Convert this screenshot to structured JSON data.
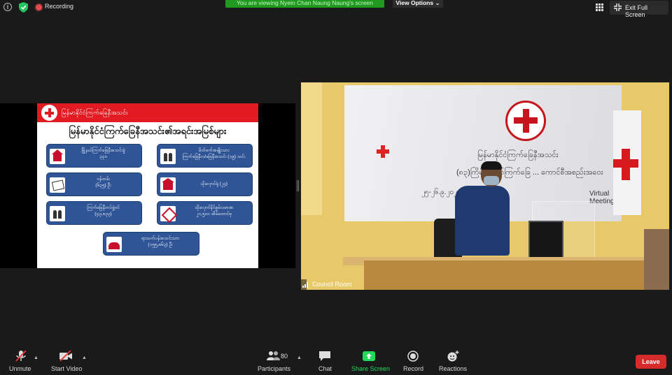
{
  "topbar": {
    "recording_label": "Recording",
    "viewing_banner": "You are viewing Nyein Chan Naung Naung's screen",
    "view_options_label": "View Options",
    "exit_fullscreen_label": "Exit Full Screen"
  },
  "slide": {
    "org_name": "မြန်မာနိုင်ငံကြက်ခြေနီအသင်း",
    "title": "မြန်မာနိုင်ငံကြက်ခြေနီအသင်း၏အရင်းအမြစ်များ",
    "boxes": [
      {
        "line1": "မြို့နယ်ကြက်ခြေနီအသင်းခွဲ",
        "line2": "၃၃၀"
      },
      {
        "line1": "မိတ်ဖက်အမျိုးသား",
        "line2": "ကြက်ခြေနီလ/ခြေနီအသင်း (၁၉) သင်း"
      },
      {
        "line1": "ဝန်ထမ်း",
        "line2": "(၆၃၅) ဦး"
      },
      {
        "line1": "သိုလှောင်ရုံ (၂၄)",
        "line2": ""
      },
      {
        "line1": "ကြက်ခြေနီတပ်ဖွဲ့ဝင်",
        "line2": "(၄၃,၈၃၃)"
      },
      {
        "line1": "သိုလှောင်နိုင်စွမ်းပမာဏ",
        "line2": "၂၁,၅၀၀ အိမ်ထောင်စု"
      },
      {
        "line1": "ရာသက်ပန်အသင်းသား",
        "line2": "(၁၅၅,၈၆၃) ဦး"
      }
    ]
  },
  "video": {
    "banner_line1": "မြန်မာနိုင်ငံကြက်ခြေနီအသင်း",
    "banner_line2": "(၈၃)ကြိမ်မြောက်ကြက်ခြေ ... ကောင်စီအစည်းအဝေး",
    "banner_date": "၂၅-၂၆.၉.၂၀၂၀",
    "banner_virtual": "Virtual Meeting",
    "participant_name": "Council Room"
  },
  "toolbar": {
    "unmute_label": "Unmute",
    "start_video_label": "Start Video",
    "participants_label": "Participants",
    "participants_count": "80",
    "chat_label": "Chat",
    "share_screen_label": "Share Screen",
    "record_label": "Record",
    "reactions_label": "Reactions",
    "leave_label": "Leave"
  },
  "colors": {
    "banner_green": "#1f9a1f",
    "share_green": "#23d959",
    "leave_red": "#d52b2b",
    "slide_red": "#e21b22",
    "slide_blue": "#2f5597"
  }
}
